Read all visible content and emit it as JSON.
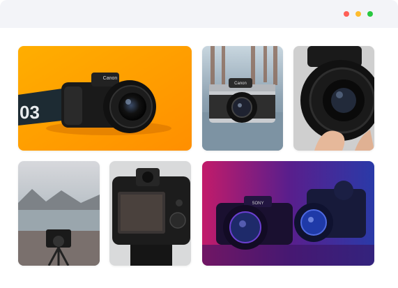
{
  "window": {
    "controls": [
      {
        "name": "close",
        "color": "#ff5f57"
      },
      {
        "name": "minimize",
        "color": "#febc2e"
      },
      {
        "name": "maximize",
        "color": "#28c840"
      }
    ]
  },
  "gallery": {
    "items": [
      {
        "subject": "camera-on-orange",
        "camera_brand": "Canon",
        "strap_text": "03"
      },
      {
        "subject": "retro-camera-on-pier",
        "camera_brand": "Canon"
      },
      {
        "subject": "lens-held-in-hand"
      },
      {
        "subject": "camera-on-tripod-at-lake"
      },
      {
        "subject": "camera-back-screen"
      },
      {
        "subject": "cameras-in-neon-light",
        "camera_brand": "SONY"
      }
    ]
  }
}
